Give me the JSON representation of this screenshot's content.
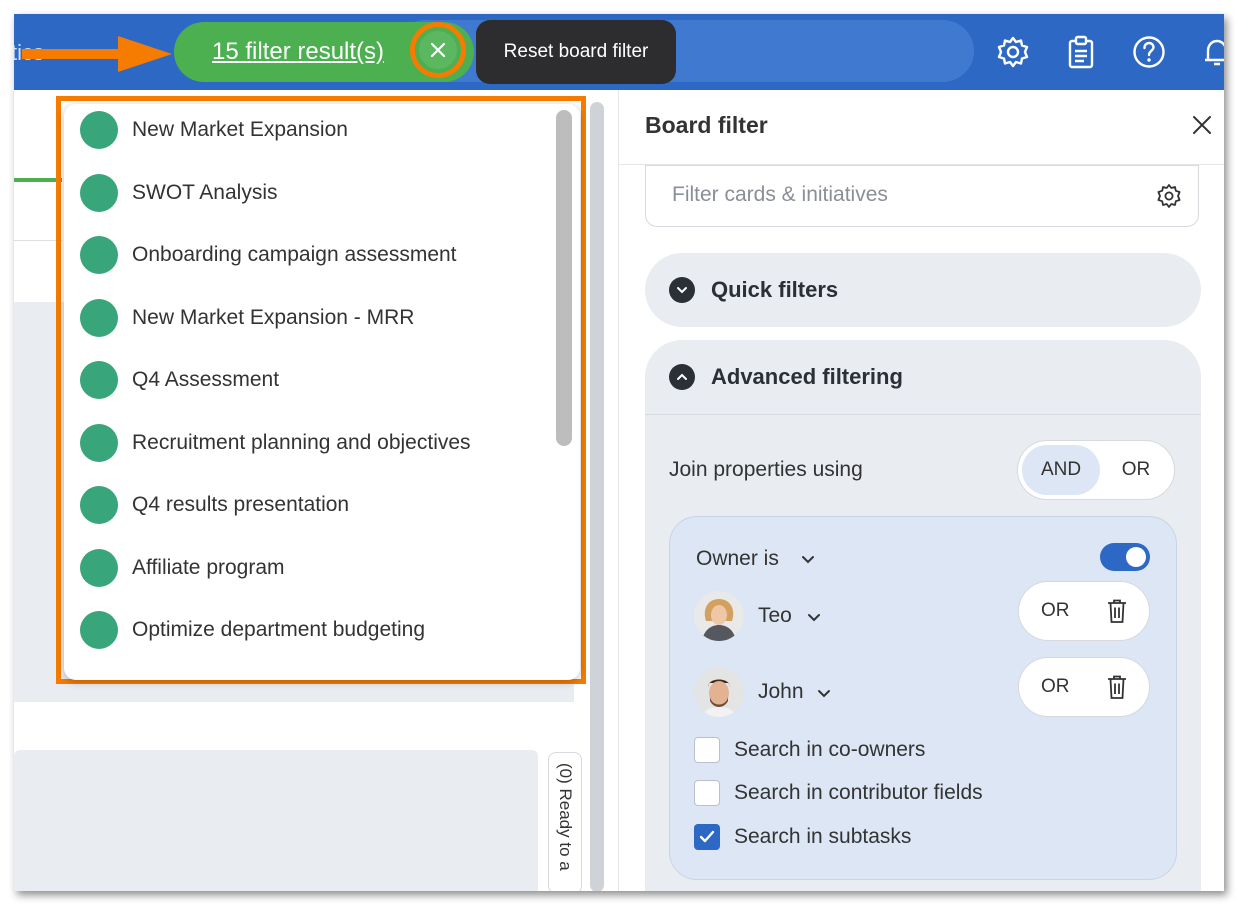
{
  "topbar": {
    "app_title": "ytics",
    "filter_results": "15 filter result(s)",
    "tooltip": "Reset board filter",
    "icons": [
      "chevron-down-icon",
      "gear-icon",
      "clipboard-icon",
      "help-icon",
      "bell-icon"
    ]
  },
  "results_dropdown": {
    "items": [
      "New Market Expansion",
      "SWOT Analysis",
      "Onboarding campaign assessment",
      "New Market Expansion - MRR",
      "Q4 Assessment",
      "Recruitment planning and objectives",
      "Q4 results presentation",
      "Affiliate program",
      "Optimize department budgeting"
    ]
  },
  "board": {
    "lane_label": "(0) Ready to a"
  },
  "panel": {
    "title": "Board filter",
    "search_placeholder": "Filter cards & initiatives",
    "quick_filters_label": "Quick filters",
    "advanced_label": "Advanced filtering",
    "join_label": "Join properties using",
    "join_and": "AND",
    "join_or": "OR",
    "owner_label": "Owner is",
    "owner_toggle_on": true,
    "people": [
      {
        "name": "Teo",
        "connector": "OR"
      },
      {
        "name": "John",
        "connector": "OR"
      }
    ],
    "checkboxes": [
      {
        "label": "Search in co-owners",
        "checked": false
      },
      {
        "label": "Search in contributor fields",
        "checked": false
      },
      {
        "label": "Search in subtasks",
        "checked": true
      }
    ]
  },
  "colors": {
    "topbar": "#2d68c4",
    "filter_green": "#4caf50",
    "highlight_orange": "#f57c00",
    "item_dot": "#38a57a"
  }
}
